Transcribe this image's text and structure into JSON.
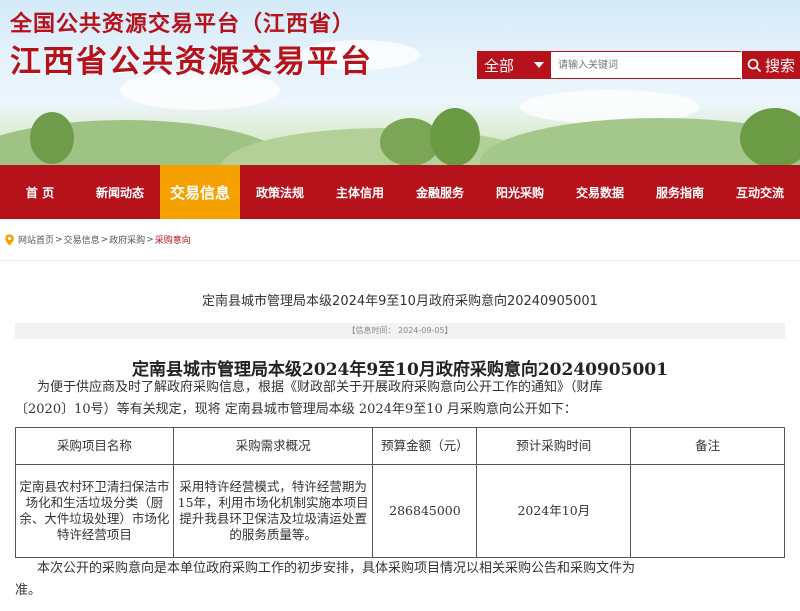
{
  "header": {
    "subtitle": "全国公共资源交易平台（江西省）",
    "title": "江西省公共资源交易平台"
  },
  "search": {
    "scope_label": "全部",
    "placeholder": "请输入关键词",
    "button_label": "搜索"
  },
  "nav": {
    "items": [
      {
        "label": "首 页"
      },
      {
        "label": "新闻动态"
      },
      {
        "label": "交易信息"
      },
      {
        "label": "政策法规"
      },
      {
        "label": "主体信用"
      },
      {
        "label": "金融服务"
      },
      {
        "label": "阳光采购"
      },
      {
        "label": "交易数据"
      },
      {
        "label": "服务指南"
      },
      {
        "label": "互动交流"
      }
    ],
    "active_index": 2
  },
  "breadcrumb": {
    "items": [
      "网站首页",
      "交易信息",
      "政府采购",
      "采购意向"
    ],
    "separator": ">"
  },
  "article": {
    "title": "定南县城市管理局本级2024年9至10月政府采购意向20240905001",
    "info": "【信息时间：  2024-09-05】",
    "doc_title": "定南县城市管理局本级2024年9至10月政府采购意向20240905001",
    "intro_line1": "为便于供应商及时了解政府采购信息，根据《财政部关于开展政府采购意向公开工作的通知》（财库",
    "intro_line2": "〔2020〕10号）等有关规定，现将 定南县城市管理局本级 2024年9至10 月采购意向公开如下：",
    "table": {
      "headers": [
        "采购项目名称",
        "采购需求概况",
        "预算金额（元）",
        "预计采购时间",
        "备注"
      ],
      "rows": [
        {
          "name": "定南县农村环卫清扫保洁市场化和生活垃圾分类（厨余、大件垃圾处理）市场化特许经营项目",
          "summary": "采用特许经营模式，特许经营期为15年，利用市场化机制实施本项目提升我县环卫保洁及垃圾清运处置的服务质量等。",
          "budget": "286845000",
          "time": "2024年10月",
          "note": ""
        }
      ]
    },
    "closing_line1": "本次公开的采购意向是本单位政府采购工作的初步安排，具体采购项目情况以相关采购公告和采购文件为",
    "closing_line2": "准。"
  },
  "colors": {
    "brand_red": "#b5121b",
    "active_orange": "#f5a100"
  }
}
